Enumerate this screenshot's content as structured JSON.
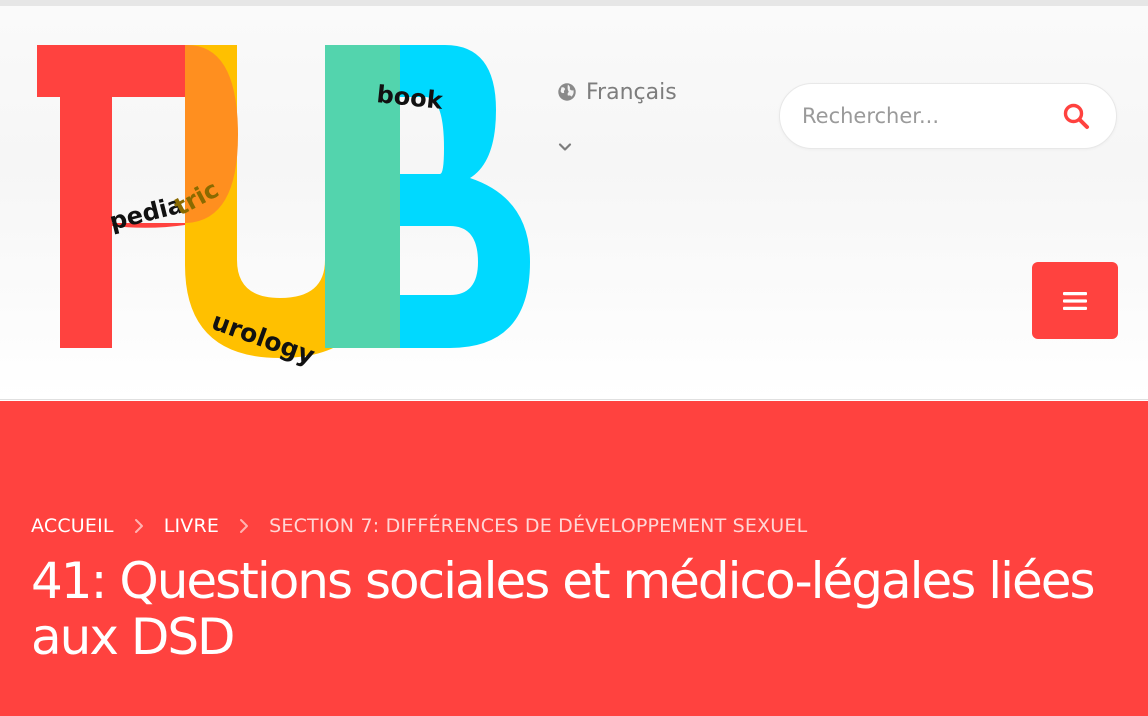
{
  "logo": {
    "letters": "PUB",
    "word_pediatric_part1": "pedia",
    "word_pediatric_part2": "tric",
    "word_urology": "urology",
    "word_book": "book",
    "colors": {
      "red": "#ff423f",
      "orange": "#ff8f1f",
      "yellow": "#ffc000",
      "green": "#53d4ad",
      "cyan": "#00d9ff"
    }
  },
  "language": {
    "label": "Français",
    "icon": "globe-icon",
    "dropdown_icon": "chevron-down-icon"
  },
  "search": {
    "placeholder": "Rechercher...",
    "icon": "search-icon"
  },
  "menu": {
    "icon": "hamburger-icon"
  },
  "breadcrumb": {
    "items": [
      {
        "label": "ACCUEIL"
      },
      {
        "label": "LIVRE"
      },
      {
        "label": "SECTION 7: DIFFÉRENCES DE DÉVELOPPEMENT SEXUEL"
      }
    ]
  },
  "page": {
    "title": "41: Questions sociales et médico-légales liées aux DSD"
  },
  "colors": {
    "accent": "#ff423f",
    "text_muted": "#7d7d7d"
  }
}
